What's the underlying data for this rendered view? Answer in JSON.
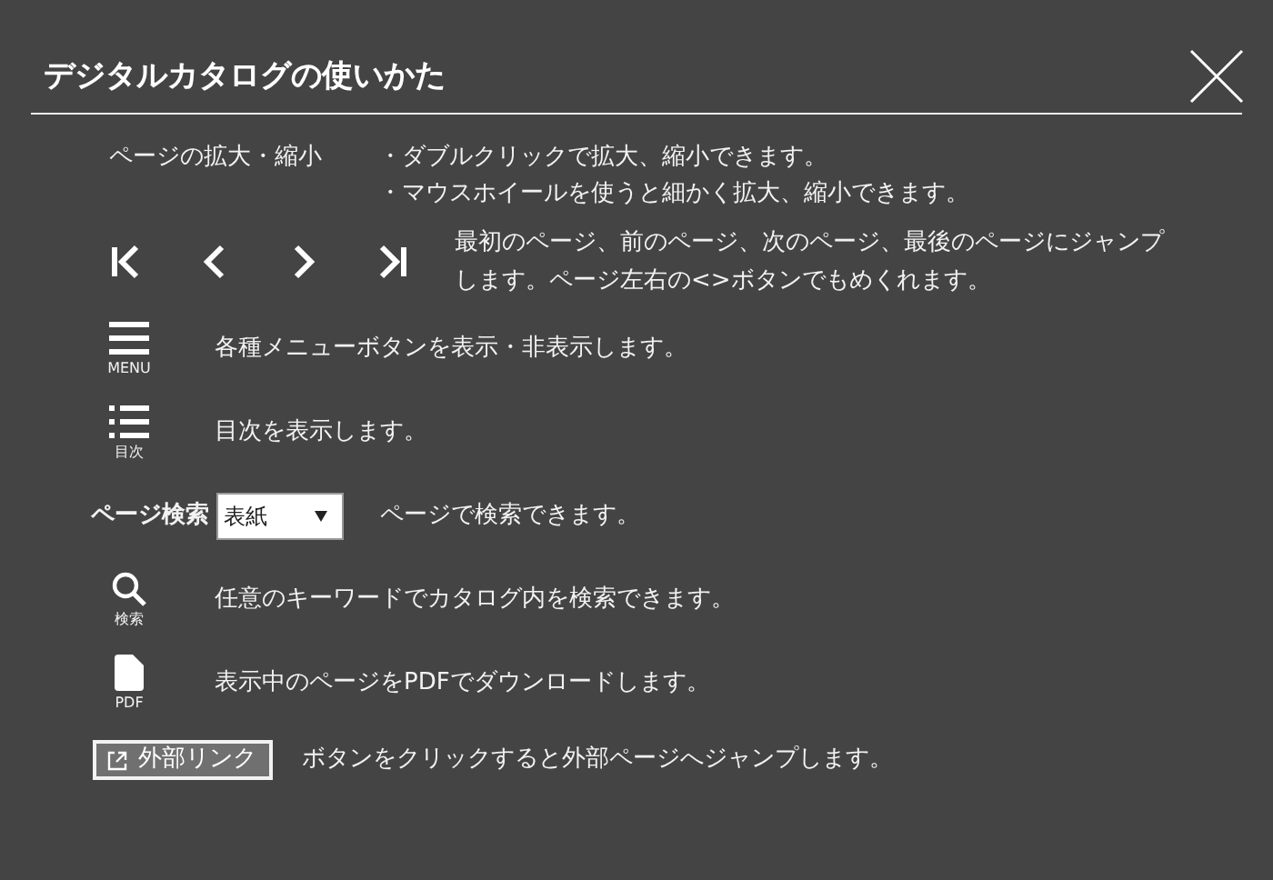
{
  "title": "デジタルカタログの使いかた",
  "zoom": {
    "label": "ページの拡大・縮小",
    "bullets": [
      "・ダブルクリックで拡大、縮小できます。",
      "・マウスホイールを使うと細かく拡大、縮小できます。"
    ]
  },
  "navigation": {
    "buttons": [
      {
        "kind": "first"
      },
      {
        "kind": "prev"
      },
      {
        "kind": "next"
      },
      {
        "kind": "last"
      }
    ],
    "description": "最初のページ、前のページ、次のページ、最後のページにジャンプします。ページ左右の<>ボタンでもめくれます。"
  },
  "tools": [
    {
      "kind": "menu",
      "caption": "MENU",
      "description": "各種メニューボタンを表示・非表示します。"
    },
    {
      "kind": "toc",
      "caption": "目次",
      "description": "目次を表示します。"
    }
  ],
  "page_search": {
    "label": "ページ検索",
    "select_value": "表紙",
    "description": "ページで検索できます。"
  },
  "tools2": [
    {
      "kind": "search",
      "caption": "検索",
      "description": "任意のキーワードでカタログ内を検索できます。"
    },
    {
      "kind": "pdf",
      "caption": "PDF",
      "description": "表示中のページをPDFでダウンロードします。"
    }
  ],
  "external_link": {
    "label": "外部リンク",
    "description": "ボタンをクリックすると外部ページへジャンプします。"
  }
}
